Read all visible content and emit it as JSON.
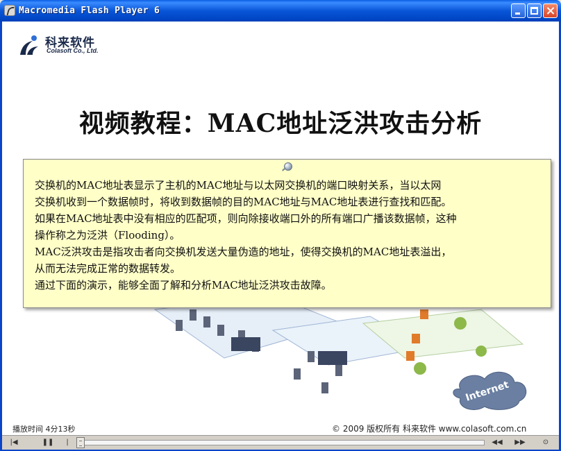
{
  "window": {
    "title": "Macromedia Flash Player 6"
  },
  "logo": {
    "name_cn": "科来软件",
    "name_en": "Colasoft Co., Ltd."
  },
  "slide": {
    "title": "视频教程：MAC地址泛洪攻击分析",
    "note_lines": [
      "交换机的MAC地址表显示了主机的MAC地址与以太网交换机的端口映射关系，当以太网",
      "交换机收到一个数据帧时，将收到数据帧的目的MAC地址与MAC地址表进行查找和匹配。",
      "如果在MAC地址表中没有相应的匹配项，则向除接收端口外的所有端口广播该数据帧，这种",
      "操作称之为泛洪（Flooding）。",
      "MAC泛洪攻击是指攻击者向交换机发送大量伪造的地址，使得交换机的MAC地址表溢出，",
      "从而无法完成正常的数据转发。",
      "通过下面的演示，能够全面了解和分析MAC地址泛洪攻击故障。"
    ],
    "diagram_cloud_label": "Internet"
  },
  "footer": {
    "play_time": "播放时间  4分13秒",
    "copyright": "© 2009 版权所有  科来软件  www.colasoft.com.cn"
  },
  "controls": {
    "rewind_icon": "rewind-to-start-icon",
    "pause_icon": "pause-icon",
    "back_icon": "step-back-icon",
    "forward_icon": "step-forward-icon",
    "exit_icon": "exit-icon",
    "progress": 0.0
  }
}
